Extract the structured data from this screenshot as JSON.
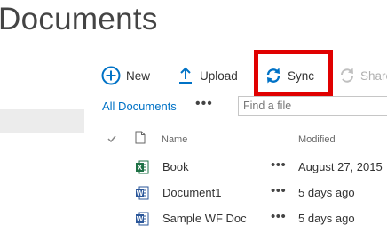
{
  "page": {
    "title": "Documents"
  },
  "toolbar": {
    "new_label": "New",
    "upload_label": "Upload",
    "sync_label": "Sync",
    "share_label": "Share"
  },
  "view": {
    "current": "All Documents",
    "more": "•••"
  },
  "search": {
    "placeholder": "Find a file"
  },
  "columns": {
    "name": "Name",
    "modified": "Modified"
  },
  "files": [
    {
      "name": "Book",
      "type": "excel",
      "modified": "August 27, 2015"
    },
    {
      "name": "Document1",
      "type": "word",
      "modified": "5 days ago"
    },
    {
      "name": "Sample WF Doc",
      "type": "word",
      "modified": "5 days ago"
    }
  ],
  "row_more": "•••",
  "colors": {
    "accent": "#0072c6",
    "highlight": "#e00000",
    "excel": "#1e7145",
    "word": "#2b579a"
  }
}
